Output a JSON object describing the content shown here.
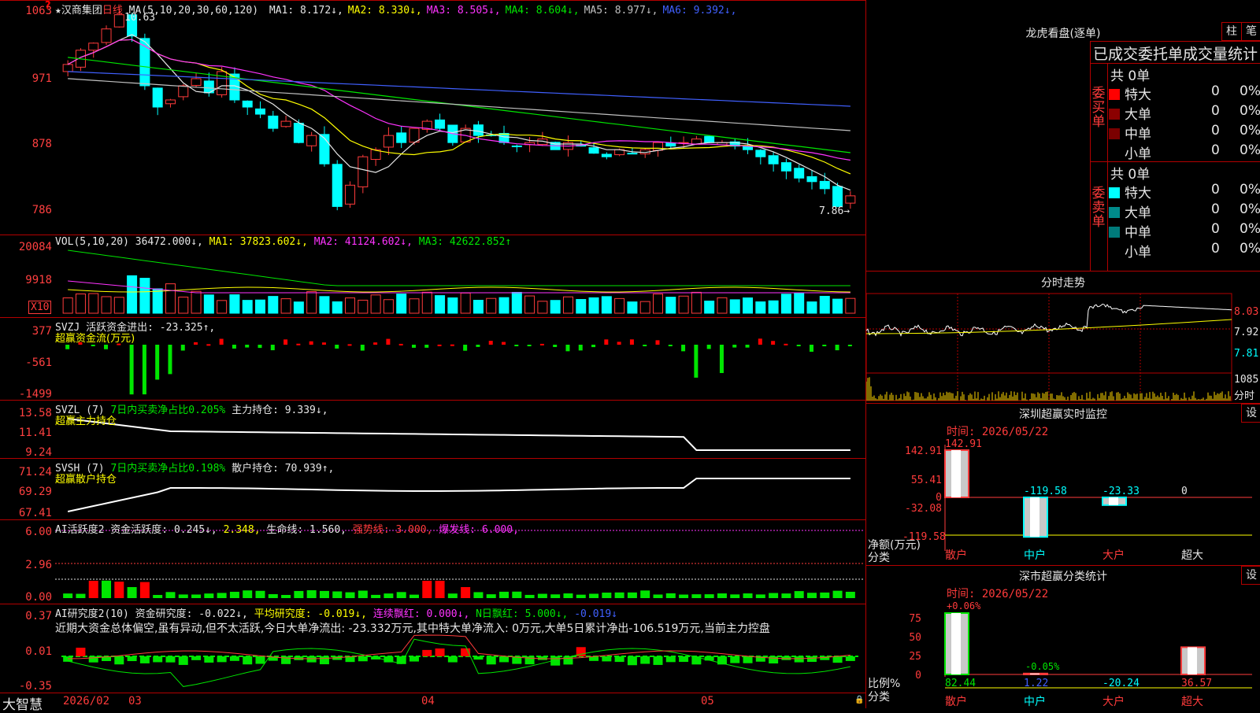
{
  "stock": {
    "name": "★汉商集团",
    "period": "日线",
    "ma_label": "MA(5,10,20,30,60,120)",
    "ma_values": [
      {
        "label": "MA1:",
        "value": "8.172↓",
        "color": "#e6e6e6"
      },
      {
        "label": "MA2:",
        "value": "8.330↓",
        "color": "#ffff00"
      },
      {
        "label": "MA3:",
        "value": "8.505↓",
        "color": "#ff33ff"
      },
      {
        "label": "MA4:",
        "value": "8.604↓",
        "color": "#00e600"
      },
      {
        "label": "MA5:",
        "value": "8.977↓",
        "color": "#c0c0c0"
      },
      {
        "label": "MA6:",
        "value": "9.392↓",
        "color": "#4060ff"
      }
    ],
    "high_marker": "10.63",
    "low_marker": "7.86→",
    "price_ticks": [
      "1063",
      "971",
      "878",
      "786"
    ],
    "warn_mark": "?"
  },
  "vol": {
    "header": "VOL(5,10,20)",
    "value": "36472.000↓,",
    "ma1": "MA1: 37823.602↓,",
    "ma2": "MA2: 41124.602↓,",
    "ma3": "MA3: 42622.852↑",
    "ticks": [
      "20084",
      "9918"
    ],
    "unit": "X10"
  },
  "svzj": {
    "header": "SVZJ  活跃资金进出: -23.325↑,",
    "subtitle": "超赢资金流(万元)",
    "ticks": [
      "377",
      "-561",
      "-1499"
    ]
  },
  "svzl": {
    "header_a": "SVZL (7)",
    "header_b": "7日内买卖净占比0.205%",
    "header_c": "主力持仓: 9.339↓,",
    "subtitle": "超赢主力持仓",
    "ticks": [
      "13.58",
      "11.41",
      "9.24"
    ]
  },
  "svsh": {
    "header_a": "SVSH (7)",
    "header_b": "7日内买卖净占比0.198%",
    "header_c": "散户持仓: 70.939↑,",
    "subtitle": "超赢散户持仓",
    "ticks": [
      "71.24",
      "69.29",
      "67.41"
    ]
  },
  "ai1": {
    "header_a": "AI活跃度2 资金活跃度: 0.245↓,",
    "header_b": "2.348,",
    "header_c": "生命线: 1.560,",
    "header_d": "强势线: 3.000,",
    "header_e": "爆发线: 6.000,",
    "ticks": [
      "6.00",
      "2.96",
      "0.00"
    ]
  },
  "ai2": {
    "header_a": "AI研究度2(10) 资金研究度: -0.022↓,",
    "header_b": "平均研究度: -0.019↓,",
    "header_c": "连续飘红: 0.000↓,",
    "header_d": "N日飘红: 5.000↓,",
    "header_e": "-0.019↓",
    "comment": "近期大资金总体偏空,虽有异动,但不太活跃,今日大单净流出: -23.332万元,其中特大单净流入: 0万元,大单5日累计净出-106.519万元,当前主力控盘",
    "ticks": [
      "0.37",
      "0.01",
      "-0.35"
    ]
  },
  "bottom": {
    "brand": "大智慧",
    "dates": [
      "2026/02",
      "03",
      "04",
      "05"
    ]
  },
  "right": {
    "lhb_title": "龙虎看盘(逐单)",
    "btn_col": "柱",
    "btn_bi": "笔",
    "stat_title": "已成交委托单成交量统计",
    "buy_label": "委买单",
    "sell_label": "委卖单",
    "buy_total": "共 0单",
    "sell_total": "共 0单",
    "buy_rows": [
      {
        "name": "特大",
        "count": "0",
        "pct": "0%",
        "color": "#ff0000"
      },
      {
        "name": "大单",
        "count": "0",
        "pct": "0%",
        "color": "#8b0000"
      },
      {
        "name": "中单",
        "count": "0",
        "pct": "0%",
        "color": "#7a0000"
      },
      {
        "name": "小单",
        "count": "0",
        "pct": "0%",
        "color": ""
      }
    ],
    "sell_rows": [
      {
        "name": "特大",
        "count": "0",
        "pct": "0%",
        "color": "#00ffff"
      },
      {
        "name": "大单",
        "count": "0",
        "pct": "0%",
        "color": "#008b8b"
      },
      {
        "name": "中单",
        "count": "0",
        "pct": "0%",
        "color": "#007a7a"
      },
      {
        "name": "小单",
        "count": "0",
        "pct": "0%",
        "color": ""
      }
    ],
    "intraday_title": "分时走势",
    "intraday_ticks": [
      "8.03",
      "7.92",
      "7.81"
    ],
    "intraday_vol": "1085",
    "intraday_vol_unit": "分时",
    "sz_title": "深圳超赢实时监控",
    "sz_time": "时间: 2026/05/22",
    "sz_ticks": [
      "142.91",
      "55.41",
      "0",
      "-32.08",
      "-119.58"
    ],
    "sz_axis_label": "净额(万元)",
    "sz_cat_label": "分类",
    "sz_bars": [
      {
        "cat": "散户",
        "value": 142.91,
        "label": "142.91",
        "cat_color": "#ff3b3b",
        "label_color": "#ff3b3b"
      },
      {
        "cat": "中户",
        "value": -119.58,
        "label": "-119.58",
        "cat_color": "#00ffff",
        "label_color": "#00ffff"
      },
      {
        "cat": "大户",
        "value": -23.33,
        "label": "-23.33",
        "cat_color": "#ff3b3b",
        "label_color": "#00ffff"
      },
      {
        "cat": "超大",
        "value": 0,
        "label": "0",
        "cat_color": "#e6e6e6",
        "label_color": "#e6e6e6"
      }
    ],
    "sh_title": "深市超赢分类统计",
    "sh_time": "时间: 2026/05/22",
    "sh_ticks": [
      "75",
      "50",
      "25",
      "0"
    ],
    "sh_axis_label": "比例%",
    "sh_cat_label": "分类",
    "sh_top_labels": [
      "+0.06%",
      "-0.05%"
    ],
    "sh_bars": [
      {
        "cat": "散户",
        "value": 82.44,
        "label": "82.44",
        "cat_color": "#ff3b3b",
        "label_color": "#00e600"
      },
      {
        "cat": "中户",
        "value": 1.22,
        "label": "1.22",
        "cat_color": "#00ffff",
        "label_color": "#4060ff"
      },
      {
        "cat": "大户",
        "value": -20.24,
        "label": "-20.24",
        "cat_color": "#ff3b3b",
        "label_color": "#00ffff"
      },
      {
        "cat": "超大",
        "value": 36.57,
        "label": "36.57",
        "cat_color": "#ff3b3b",
        "label_color": "#ff3b3b"
      }
    ],
    "set_btn": "设"
  }
}
